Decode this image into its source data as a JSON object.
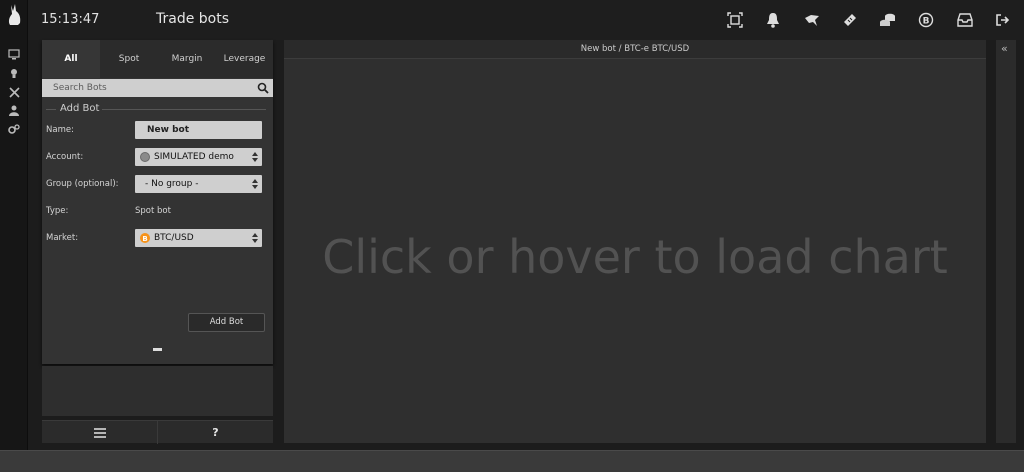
{
  "header": {
    "time": "15:13:47",
    "title": "Trade bots"
  },
  "top_icons": [
    "screen-frame-icon",
    "bell-icon",
    "hand-coins-icon",
    "ticket-icon",
    "coins-stack-icon",
    "bitcoin-refresh-icon",
    "inbox-icon",
    "logout-icon"
  ],
  "rail_icons": [
    "monitor-icon",
    "lightbulb-icon",
    "tools-icon",
    "user-icon",
    "cogs-icon"
  ],
  "tabs": [
    {
      "label": "All",
      "active": true
    },
    {
      "label": "Spot",
      "active": false
    },
    {
      "label": "Margin",
      "active": false
    },
    {
      "label": "Leverage",
      "active": false
    }
  ],
  "search": {
    "placeholder": "Search Bots"
  },
  "add_bot": {
    "legend": "Add Bot",
    "name_label": "Name:",
    "name_value": "New bot",
    "account_label": "Account:",
    "account_value": "SIMULATED demo",
    "group_label": "Group (optional):",
    "group_value": "- No group -",
    "type_label": "Type:",
    "type_value": "Spot bot",
    "market_label": "Market:",
    "market_value": "BTC/USD",
    "button": "Add Bot"
  },
  "bottom": {
    "help": "?"
  },
  "main": {
    "header": "New bot / BTC-e BTC/USD",
    "hint": "Click or hover to load chart"
  },
  "collapse": {
    "label": "«"
  },
  "colors": {
    "bitcoin": "#f7931a",
    "account_dot": "#8a8a8a"
  }
}
